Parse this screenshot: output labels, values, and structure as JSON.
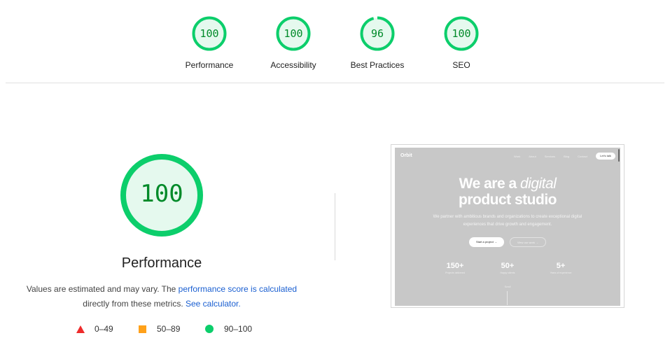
{
  "colors": {
    "pass": "#0cce6b",
    "pass_text": "#008a29",
    "pass_fill": "#e5f9ee",
    "average": "#ffa11a",
    "fail": "#ee2b2b",
    "link": "#1a5fd1"
  },
  "summary": [
    {
      "score": "100",
      "label": "Performance",
      "fraction": 1.0
    },
    {
      "score": "100",
      "label": "Accessibility",
      "fraction": 1.0
    },
    {
      "score": "96",
      "label": "Best Practices",
      "fraction": 0.96
    },
    {
      "score": "100",
      "label": "SEO",
      "fraction": 1.0
    }
  ],
  "main": {
    "score": "100",
    "fraction": 1.0,
    "title": "Performance",
    "desc_pre": "Values are estimated and may vary. The ",
    "desc_link1": "performance score is calculated",
    "desc_mid": "directly from these metrics.",
    "desc_link2": "See calculator."
  },
  "legend": [
    {
      "range": "0–49",
      "shape": "triangle"
    },
    {
      "range": "50–89",
      "shape": "square"
    },
    {
      "range": "90–100",
      "shape": "circle"
    }
  ],
  "screenshot": {
    "logo": "Orbit",
    "nav": [
      "Work",
      "About",
      "Services",
      "Blog",
      "Contact"
    ],
    "cta": "Let's talk",
    "headline_1": "We are a ",
    "headline_1_em": "digital",
    "headline_2": "product studio",
    "sub": "We partner with ambitious brands and organizations to create exceptional digital experiences that drive growth and engagement.",
    "btn_primary": "Start a project →",
    "btn_secondary": "View our work →",
    "stats": [
      {
        "value": "150+",
        "label": "Projects delivered"
      },
      {
        "value": "50+",
        "label": "Happy clients"
      },
      {
        "value": "5+",
        "label": "Years of experience"
      }
    ],
    "scroll_hint": "Scroll"
  }
}
